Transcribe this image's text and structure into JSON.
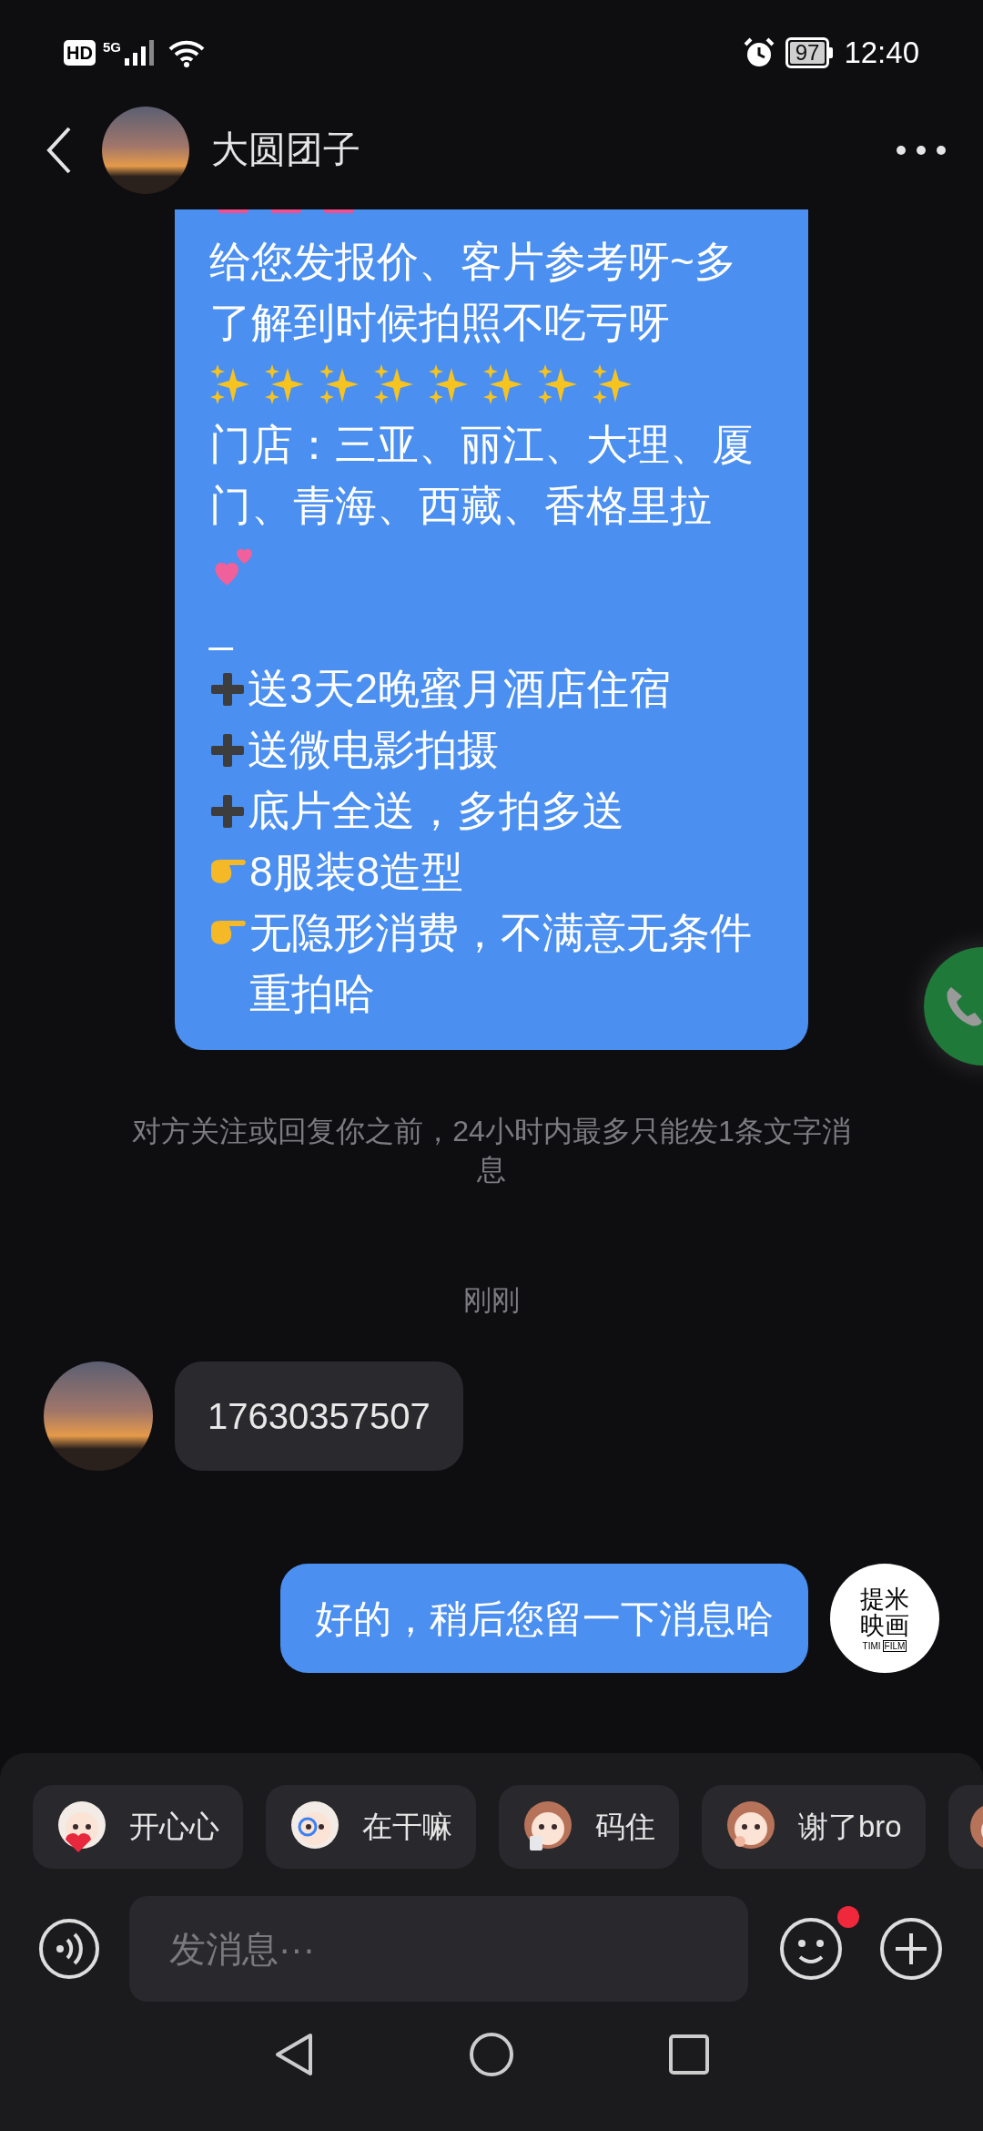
{
  "status_bar": {
    "hd": "HD",
    "network": "5G",
    "battery": "97",
    "time": "12:40"
  },
  "header": {
    "name": "大圆团子"
  },
  "messages": [
    {
      "kind": "outgoing_long",
      "lines": [
        {
          "kind": "hearts"
        },
        {
          "kind": "text",
          "text": "给您发报价、客片参考呀~多了解到时候拍照不吃亏呀"
        },
        {
          "kind": "sparkles"
        },
        {
          "kind": "text",
          "text": "门店：三亚、丽江、大理、厦门、青海、西藏、香格里拉"
        },
        {
          "kind": "heart_pair"
        },
        {
          "kind": "text",
          "text": "_"
        },
        {
          "kind": "plus",
          "text": "送3天2晚蜜月酒店住宿"
        },
        {
          "kind": "plus",
          "text": "送微电影拍摄"
        },
        {
          "kind": "plus",
          "text": "底片全送，多拍多送"
        },
        {
          "kind": "point",
          "text": "8服装8造型"
        },
        {
          "kind": "point",
          "text": "无隐形消费，不满意无条件重拍哈"
        }
      ]
    },
    {
      "kind": "notice",
      "text": "对方关注或回复你之前，24小时内最多只能发1条文字消息"
    },
    {
      "kind": "time",
      "text": "刚刚"
    },
    {
      "kind": "incoming",
      "text": "17630357507"
    },
    {
      "kind": "outgoing",
      "text": "好的，稍后您留一下消息哈",
      "avatar_lines": [
        "提米",
        "映画"
      ],
      "avatar_sub": [
        "TIMI",
        "FILM"
      ]
    }
  ],
  "call_button": {
    "visible": true
  },
  "quick_stickers": [
    {
      "label": "开心心"
    },
    {
      "label": "在干嘛"
    },
    {
      "label": "码住"
    },
    {
      "label": "谢了bro"
    }
  ],
  "more_sticker_visible": true,
  "composer": {
    "placeholder": "发消息···",
    "emoji_badge": true
  }
}
